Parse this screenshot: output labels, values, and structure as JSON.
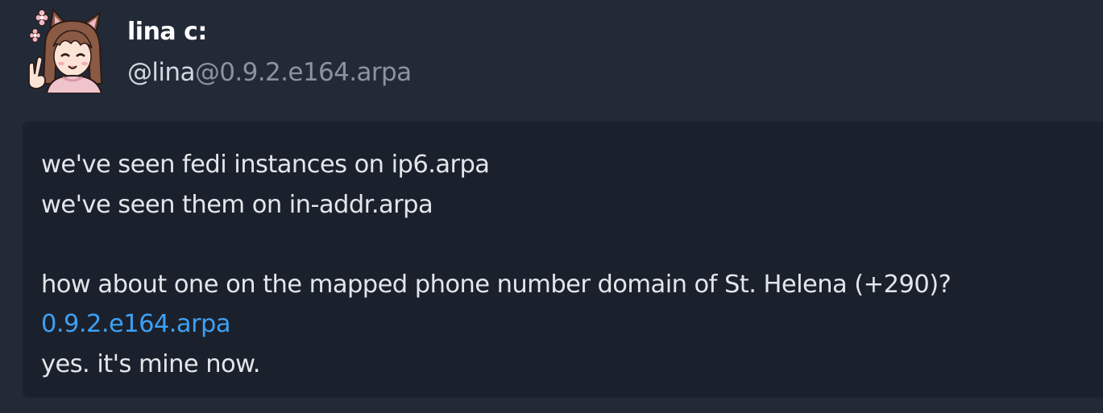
{
  "author": {
    "display_name": "lina c:",
    "handle_user": "@lina",
    "handle_domain": "@0.9.2.e164.arpa",
    "avatar_icon": "anime-cat-girl-avatar-icon"
  },
  "post": {
    "lines": [
      "we've seen fedi instances on ip6.arpa",
      "we've seen them on in-addr.arpa",
      "",
      "how about one on the mapped phone number domain of St. Helena (+290)?"
    ],
    "link_text": "0.9.2.e164.arpa",
    "closing_line": "yes. it's mine now."
  },
  "colors": {
    "background": "#222a37",
    "card": "#1b212c",
    "link": "#3ea0f5",
    "muted": "#8c939d"
  }
}
